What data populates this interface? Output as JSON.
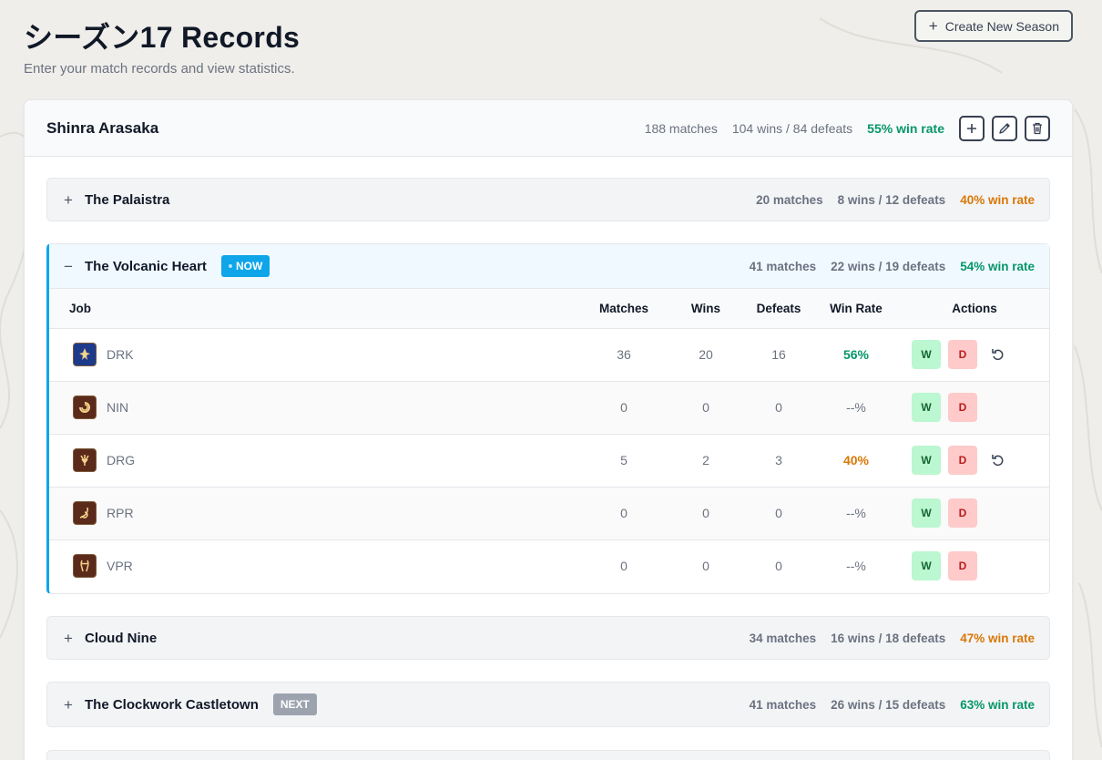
{
  "header": {
    "title": "シーズン17 Records",
    "subtitle": "Enter your match records and view statistics.",
    "create_button": "Create New Season"
  },
  "player": {
    "name": "Shinra Arasaka",
    "matches": "188 matches",
    "record": "104 wins / 84 defeats",
    "win_rate": "55% win rate"
  },
  "maps": [
    {
      "name": "The Palaistra",
      "matches": "20 matches",
      "record": "8 wins / 12 defeats",
      "win_rate": "40% win rate",
      "toggle": "+"
    },
    {
      "name": "The Volcanic Heart",
      "badge": "NOW",
      "matches": "41 matches",
      "record": "22 wins / 19 defeats",
      "win_rate": "54% win rate",
      "toggle": "−"
    },
    {
      "name": "Cloud Nine",
      "matches": "34 matches",
      "record": "16 wins / 18 defeats",
      "win_rate": "47% win rate",
      "toggle": "+"
    },
    {
      "name": "The Clockwork Castletown",
      "badge": "NEXT",
      "matches": "41 matches",
      "record": "26 wins / 15 defeats",
      "win_rate": "63% win rate",
      "toggle": "+"
    }
  ],
  "table": {
    "headers": {
      "job": "Job",
      "matches": "Matches",
      "wins": "Wins",
      "defeats": "Defeats",
      "win_rate": "Win Rate",
      "actions": "Actions"
    },
    "rows": [
      {
        "job": "DRK",
        "matches": "36",
        "wins": "20",
        "defeats": "16",
        "win_rate": "56%",
        "w": "W",
        "d": "D"
      },
      {
        "job": "NIN",
        "matches": "0",
        "wins": "0",
        "defeats": "0",
        "win_rate": "--%",
        "w": "W",
        "d": "D"
      },
      {
        "job": "DRG",
        "matches": "5",
        "wins": "2",
        "defeats": "3",
        "win_rate": "40%",
        "w": "W",
        "d": "D"
      },
      {
        "job": "RPR",
        "matches": "0",
        "wins": "0",
        "defeats": "0",
        "win_rate": "--%",
        "w": "W",
        "d": "D"
      },
      {
        "job": "VPR",
        "matches": "0",
        "wins": "0",
        "defeats": "0",
        "win_rate": "--%",
        "w": "W",
        "d": "D"
      }
    ]
  },
  "colors": {
    "good": "#059669",
    "mid": "#d97706",
    "now_badge": "#0ea5e9",
    "next_badge": "#9ca3af",
    "win_button": "#bbf7d0",
    "defeat_button": "#fecaca"
  }
}
